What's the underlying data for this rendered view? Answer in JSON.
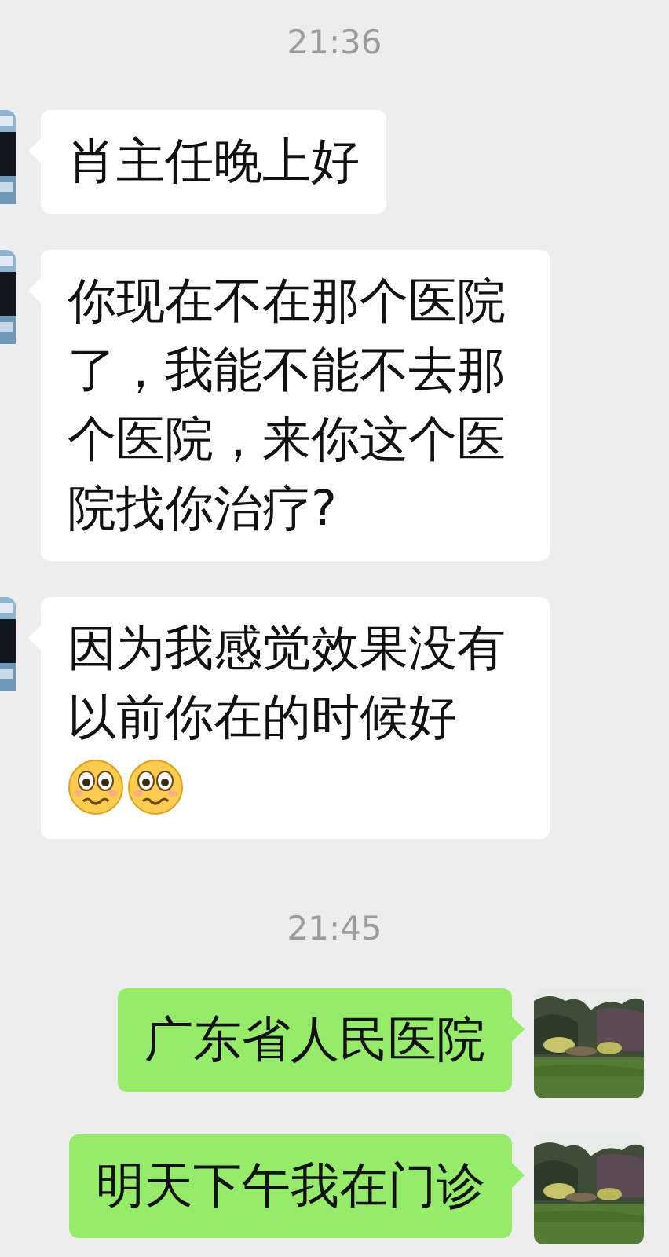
{
  "messages": [
    {
      "kind": "time",
      "text": "21:36"
    },
    {
      "kind": "message",
      "from_me": false,
      "parts": [
        {
          "kind": "text",
          "text": "肖主任晚上好"
        }
      ]
    },
    {
      "kind": "message",
      "from_me": false,
      "parts": [
        {
          "kind": "text",
          "text": "你现在不在那个医院了，我能不能不去那个医院，来你这个医院找你治疗?"
        }
      ]
    },
    {
      "kind": "message",
      "from_me": false,
      "parts": [
        {
          "kind": "text",
          "text": "因为我感觉效果没有以前你在的时候好"
        },
        {
          "kind": "emoji"
        },
        {
          "kind": "emoji"
        }
      ]
    },
    {
      "kind": "time",
      "text": "21:45"
    },
    {
      "kind": "message",
      "from_me": true,
      "parts": [
        {
          "kind": "text",
          "text": "广东省人民医院"
        }
      ]
    },
    {
      "kind": "message",
      "from_me": true,
      "parts": [
        {
          "kind": "text",
          "text": "明天下午我在门诊"
        }
      ]
    }
  ]
}
